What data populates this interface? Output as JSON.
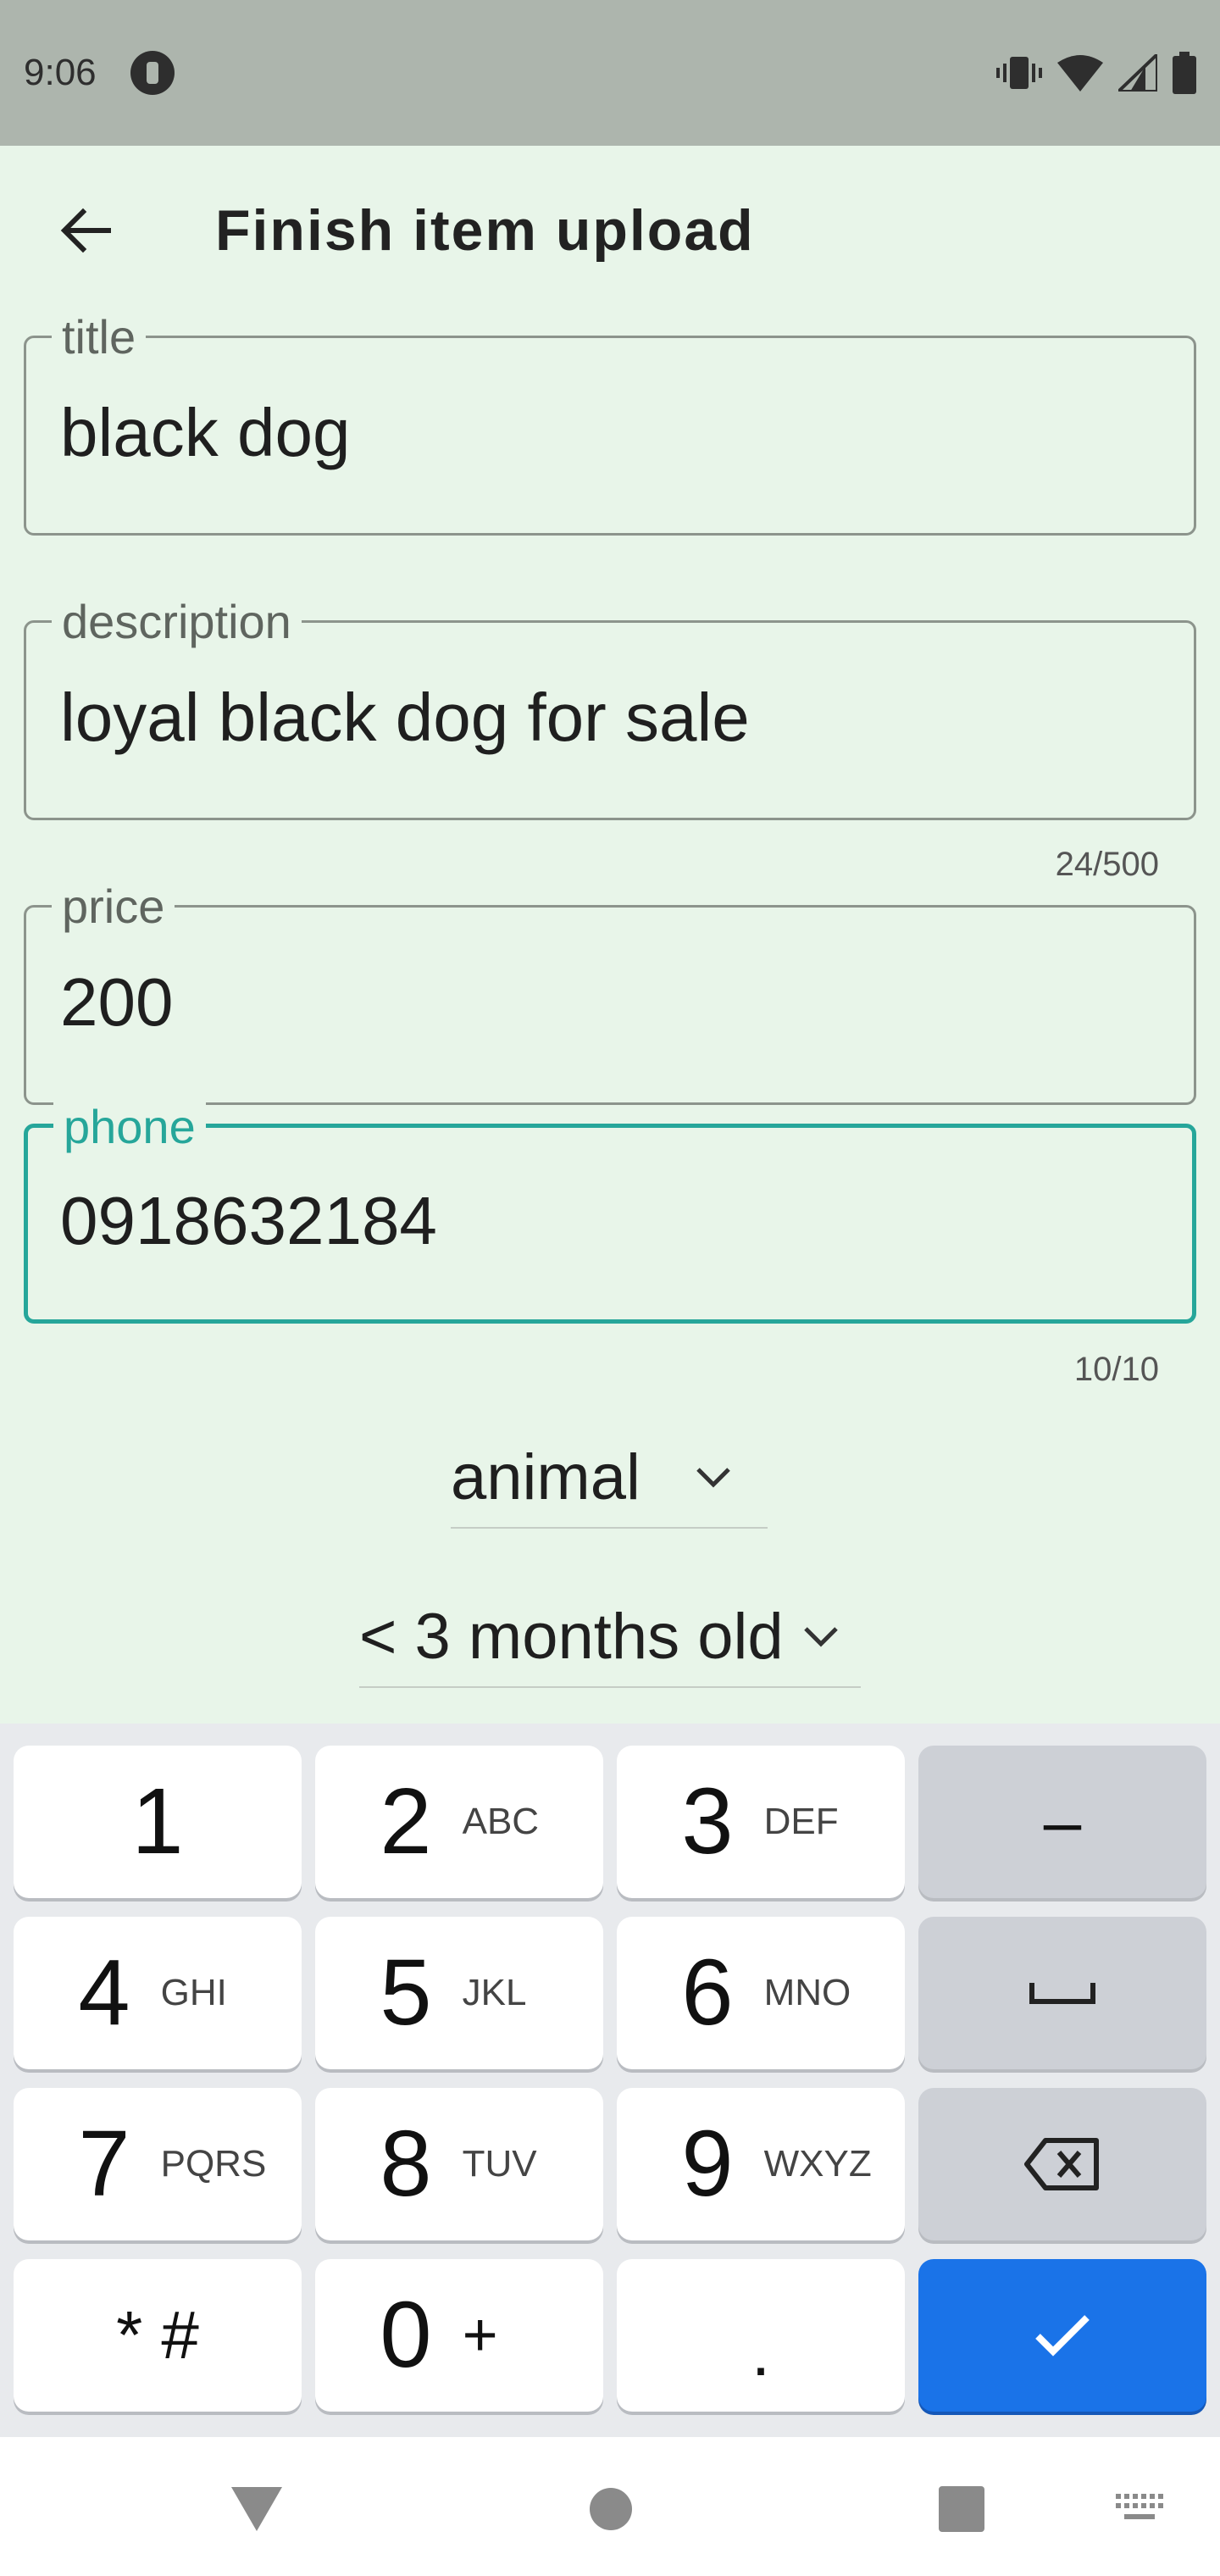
{
  "status_bar": {
    "time": "9:06"
  },
  "app_bar": {
    "title": "Finish item upload"
  },
  "form": {
    "title": {
      "label": "title",
      "value": "black dog"
    },
    "description": {
      "label": "description",
      "value": "loyal black dog for sale",
      "counter": "24/500"
    },
    "price": {
      "label": "price",
      "value": "200"
    },
    "phone": {
      "label": "phone",
      "value": "0918632184",
      "counter": "10/10"
    },
    "category": {
      "value": "animal"
    },
    "age": {
      "value": "< 3 months old"
    }
  },
  "keyboard": {
    "keys": [
      {
        "digit": "1",
        "letters": ""
      },
      {
        "digit": "2",
        "letters": "ABC"
      },
      {
        "digit": "3",
        "letters": "DEF"
      },
      {
        "digit": "4",
        "letters": "GHI"
      },
      {
        "digit": "5",
        "letters": "JKL"
      },
      {
        "digit": "6",
        "letters": "MNO"
      },
      {
        "digit": "7",
        "letters": "PQRS"
      },
      {
        "digit": "8",
        "letters": "TUV"
      },
      {
        "digit": "9",
        "letters": "WXYZ"
      },
      {
        "digit": "0",
        "letters": "+"
      }
    ],
    "minus": "–",
    "star_hash": "* #",
    "period": "."
  },
  "colors": {
    "accent": "#26a69a",
    "keyboard_action": "#1a73e8",
    "background": "#e8f5e9"
  }
}
